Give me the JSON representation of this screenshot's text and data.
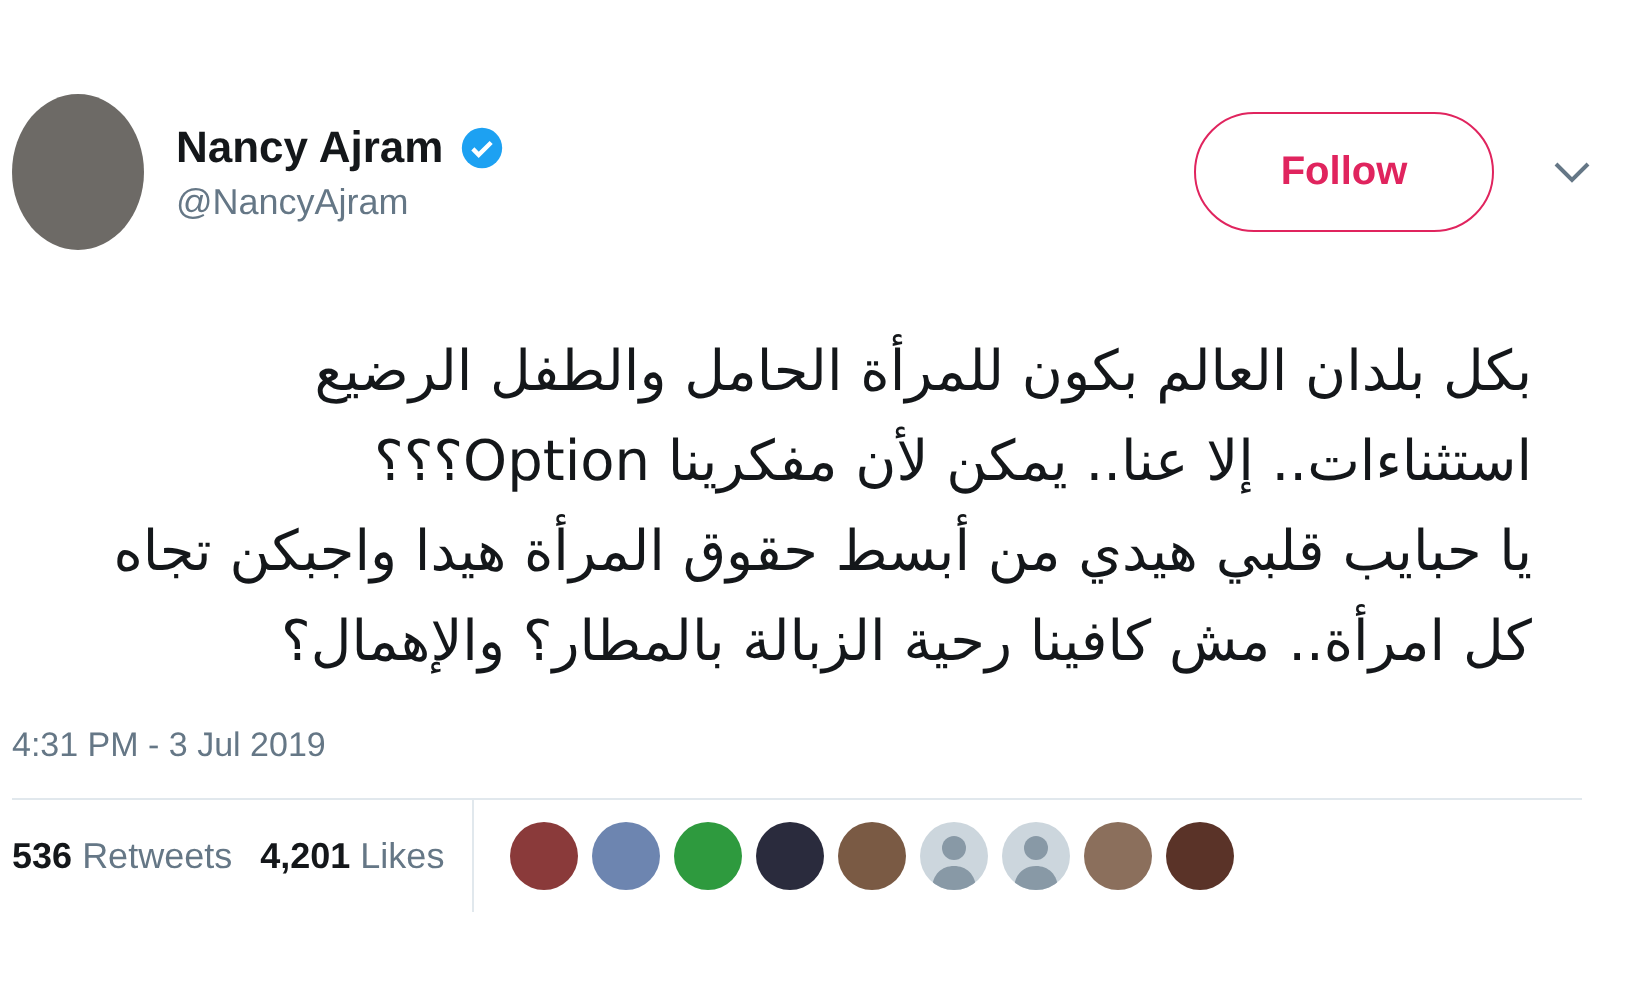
{
  "author": {
    "name": "Nancy Ajram",
    "verified": true,
    "handle": "@NancyAjram"
  },
  "follow_button": {
    "label": "Follow"
  },
  "tweet_lines": [
    "بكل بلدان العالم بكون للمرأة الحامل والطفل الرضيع",
    "استثناءات.. إلا عنا.. يمكن لأن مفكرينا Option؟؟؟",
    "يا حبايب قلبي هيدي من أبسط حقوق المرأة هيدا واجبكن تجاه",
    "كل امرأة.. مش كافينا رحية الزبالة بالمطار؟ والإهمال؟"
  ],
  "timestamp": "4:31 PM - 3 Jul 2019",
  "retweets": {
    "count": "536",
    "label": "Retweets"
  },
  "likes": {
    "count": "4,201",
    "label": "Likes"
  },
  "liker_avatars": [
    {
      "kind": "photo"
    },
    {
      "kind": "photo"
    },
    {
      "kind": "photo"
    },
    {
      "kind": "photo"
    },
    {
      "kind": "photo"
    },
    {
      "kind": "default"
    },
    {
      "kind": "default"
    },
    {
      "kind": "photo"
    },
    {
      "kind": "photo"
    }
  ]
}
